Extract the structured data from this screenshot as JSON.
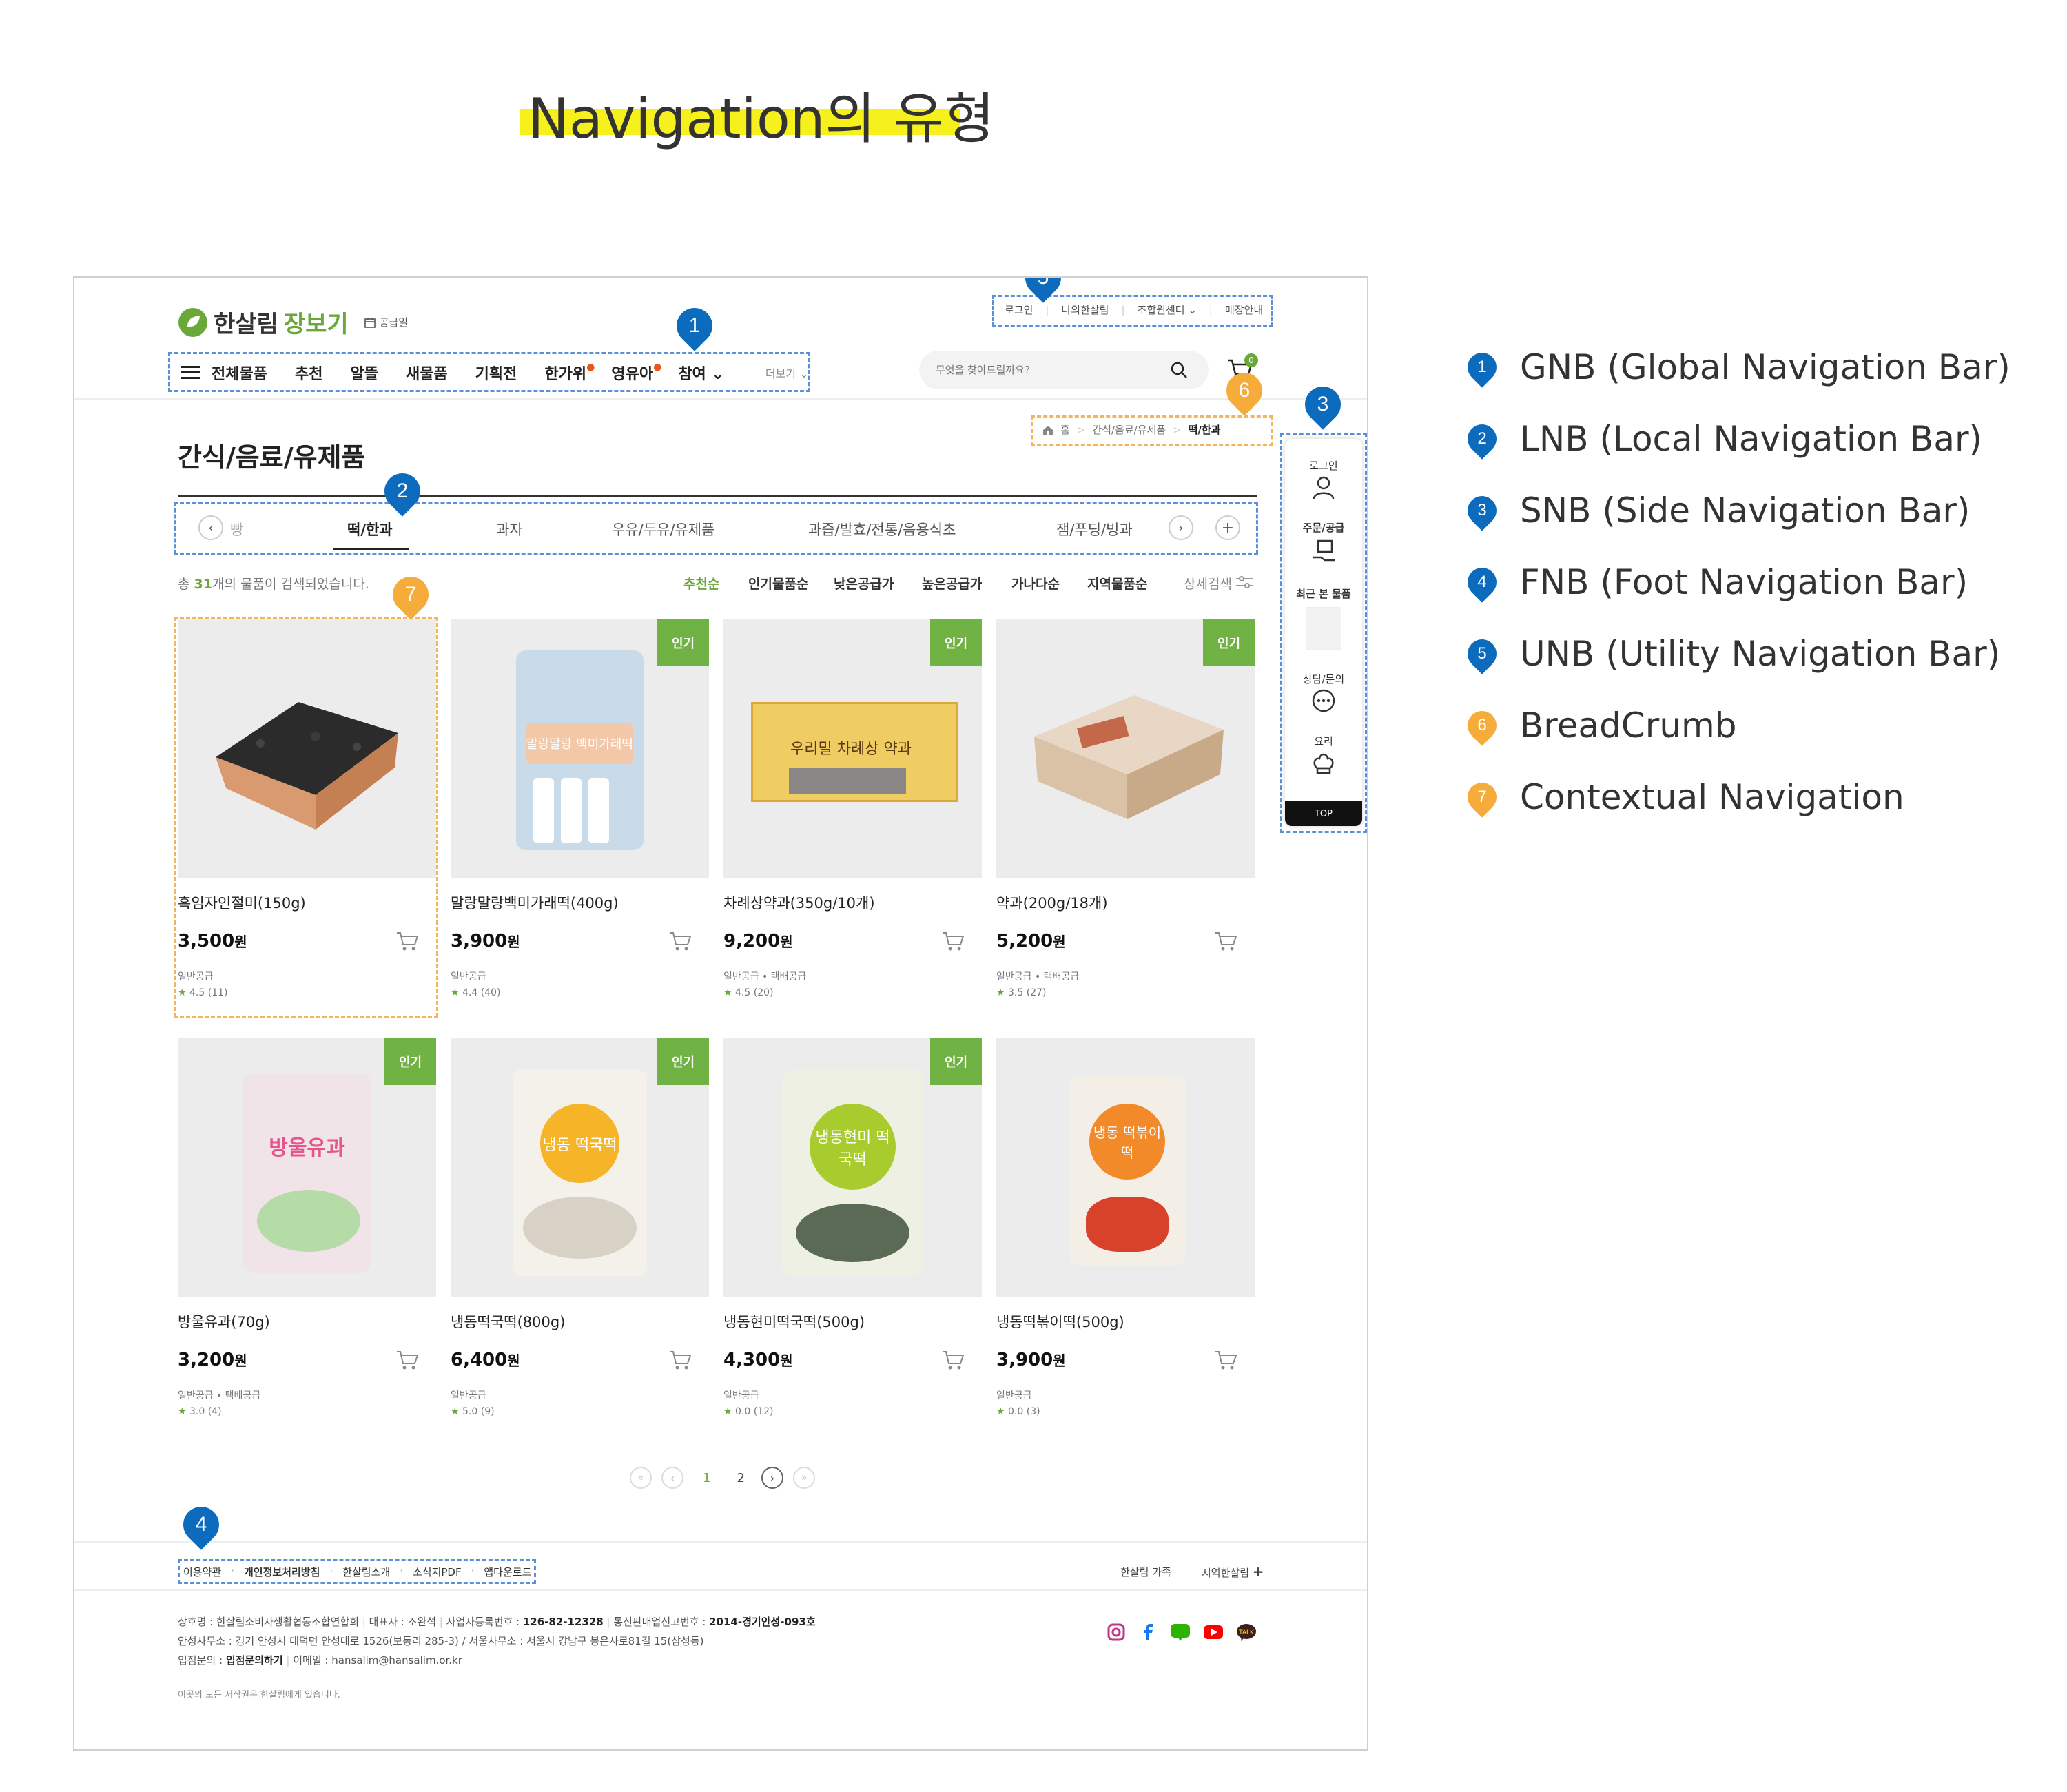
{
  "page_title": "Navigation의 유형",
  "site": {
    "logo_text": "한살림",
    "logo_sub": "장보기",
    "calendar_label": "공급일"
  },
  "unb": {
    "items": [
      "로그인",
      "나의한살림",
      "조합원센터",
      "매장안내"
    ]
  },
  "gnb": {
    "items": [
      "전체물품",
      "추천",
      "알뜰",
      "새물품",
      "기획전",
      "한가위",
      "영유아",
      "참여"
    ],
    "more": "더보기"
  },
  "search": {
    "placeholder": "무엇을 찾아드릴까요?"
  },
  "cart_count": "0",
  "breadcrumb": {
    "home": "홈",
    "parent": "간식/음료/유제품",
    "current": "떡/한과"
  },
  "category_title": "간식/음료/유제품",
  "lnb": {
    "items": [
      "빵",
      "떡/한과",
      "과자",
      "우유/두유/유제품",
      "과즙/발효/전통/음용식초",
      "잼/푸딩/빙과"
    ],
    "active": "떡/한과"
  },
  "results": {
    "prefix": "총",
    "count": "31",
    "suffix": "개의 물품이 검색되었습니다."
  },
  "sort_options": [
    "추천순",
    "인기물품순",
    "낮은공급가",
    "높은공급가",
    "가나다순",
    "지역물품순"
  ],
  "detail_search": "상세검색",
  "popular_badge": "인기",
  "products": [
    {
      "name": "흑임자인절미(150g)",
      "price": "3,500",
      "supply": "일반공급",
      "rating": "4.5 (11)",
      "popular": false
    },
    {
      "name": "말랑말랑백미가래떡(400g)",
      "price": "3,900",
      "supply": "일반공급",
      "rating": "4.4 (40)",
      "popular": true
    },
    {
      "name": "차례상약과(350g/10개)",
      "price": "9,200",
      "supply": "일반공급 • 택배공급",
      "rating": "4.5 (20)",
      "popular": true
    },
    {
      "name": "약과(200g/18개)",
      "price": "5,200",
      "supply": "일반공급 • 택배공급",
      "rating": "3.5 (27)",
      "popular": true
    },
    {
      "name": "방울유과(70g)",
      "price": "3,200",
      "supply": "일반공급 • 택배공급",
      "rating": "3.0 (4)",
      "popular": true
    },
    {
      "name": "냉동떡국떡(800g)",
      "price": "6,400",
      "supply": "일반공급",
      "rating": "5.0 (9)",
      "popular": true
    },
    {
      "name": "냉동현미떡국떡(500g)",
      "price": "4,300",
      "supply": "일반공급",
      "rating": "0.0 (12)",
      "popular": true
    },
    {
      "name": "냉동떡볶이떡(500g)",
      "price": "3,900",
      "supply": "일반공급",
      "rating": "0.0 (3)",
      "popular": false
    }
  ],
  "price_unit": "원",
  "package_labels": [
    "말랑말랑 백미가래떡",
    "우리밀 차례상 약과",
    "방울유과",
    "냉동 떡국떡",
    "냉동현미 떡국떡",
    "냉동 떡볶이떡"
  ],
  "pagination": {
    "pages": [
      "1",
      "2"
    ],
    "current": "1"
  },
  "snb": {
    "items": [
      "로그인",
      "주문/공급",
      "최근 본 물품",
      "상담/문의",
      "요리"
    ],
    "top": "TOP"
  },
  "fnb": {
    "items": [
      "이용약관",
      "개인정보처리방침",
      "한살림소개",
      "소식지PDF",
      "앱다운로드"
    ],
    "family": "한살림 가족",
    "regional": "지역한살림"
  },
  "company": {
    "line1_a": "상호명 : 한살림소비자생활협동조합연합회",
    "line1_b": "대표자 : 조완석",
    "line1_c": "사업자등록번호 :",
    "line1_c_val": "126-82-12328",
    "line1_d": "통신판매업신고번호 :",
    "line1_d_val": "2014-경기안성-093호",
    "line2": "안성사무소 : 경기 안성시 대덕면 안성대로 1526(보동리 285-3) / 서울사무소 : 서울시 강남구 봉은사로81길 15(삼성동)",
    "line3_a": "입점문의 :",
    "line3_a_val": "입점문의하기",
    "line3_b": "이메일 : hansalim@hansalim.or.kr",
    "copyright": "이곳의 모든 저작권은 한살림에게 있습니다."
  },
  "social": [
    "instagram-icon",
    "facebook-icon",
    "blog-icon",
    "youtube-icon",
    "kakaotalk-icon"
  ],
  "pins": [
    "1",
    "2",
    "3",
    "4",
    "5",
    "6",
    "7"
  ],
  "legend": [
    {
      "num": "1",
      "label": "GNB (Global Navigation Bar)",
      "color": "#0d6bbd"
    },
    {
      "num": "2",
      "label": "LNB (Local Navigation Bar)",
      "color": "#0d6bbd"
    },
    {
      "num": "3",
      "label": "SNB (Side Navigation Bar)",
      "color": "#0d6bbd"
    },
    {
      "num": "4",
      "label": "FNB (Foot Navigation Bar)",
      "color": "#0d6bbd"
    },
    {
      "num": "5",
      "label": "UNB (Utility Navigation Bar)",
      "color": "#0d6bbd"
    },
    {
      "num": "6",
      "label": "BreadCrumb",
      "color": "#f6ac3b"
    },
    {
      "num": "7",
      "label": "Contextual Navigation",
      "color": "#f6ac3b"
    }
  ],
  "colors": {
    "accent_green": "#70b244",
    "pin_blue": "#0d6bbd",
    "pin_orange": "#f6ac3b",
    "highlight": "#f6f01c"
  }
}
